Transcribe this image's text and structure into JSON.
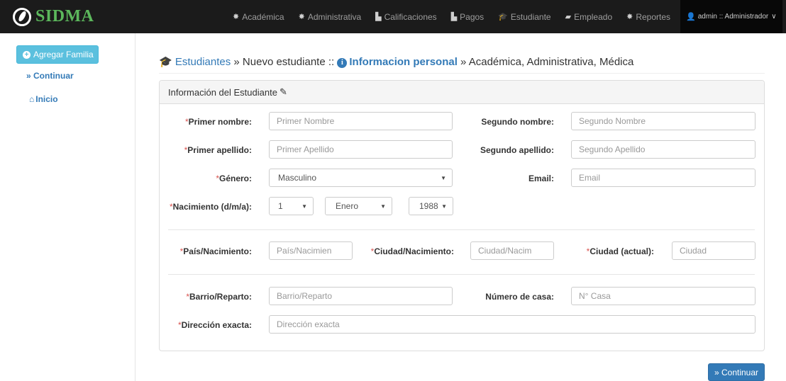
{
  "navbar": {
    "brand": "SIDMA",
    "items": [
      {
        "icon": "gear-icon",
        "glyph": "✸",
        "label": "Académica"
      },
      {
        "icon": "gear-icon",
        "glyph": "✸",
        "label": "Administrativa"
      },
      {
        "icon": "file-icon",
        "glyph": "▙",
        "label": "Calificaciones"
      },
      {
        "icon": "file-icon",
        "glyph": "▙",
        "label": "Pagos"
      },
      {
        "icon": "graduation-cap-icon",
        "glyph": "🎓",
        "label": "Estudiante"
      },
      {
        "icon": "folder-open-icon",
        "glyph": "▰",
        "label": "Empleado"
      },
      {
        "icon": "gear-icon",
        "glyph": "✸",
        "label": "Reportes"
      }
    ],
    "user": "admin :: Administrador"
  },
  "sidebar": {
    "add_family": "Agregar Familia",
    "continuar": "» Continuar",
    "inicio": "Inicio"
  },
  "breadcrumb": {
    "estudiantes": "Estudiantes",
    "nuevo": " » Nuevo estudiante :: ",
    "info_personal": "Informacion personal",
    "rest": " » Académica, Administrativa, Médica"
  },
  "panel": {
    "title": "Información del Estudiante"
  },
  "form": {
    "primer_nombre": {
      "label": "Primer nombre:",
      "placeholder": "Primer Nombre"
    },
    "segundo_nombre": {
      "label": "Segundo nombre:",
      "placeholder": "Segundo Nombre"
    },
    "primer_apellido": {
      "label": "Primer apellido:",
      "placeholder": "Primer Apellido"
    },
    "segundo_apellido": {
      "label": "Segundo apellido:",
      "placeholder": "Segundo Apellido"
    },
    "genero": {
      "label": "Género:",
      "value": "Masculino"
    },
    "email": {
      "label": "Email:",
      "placeholder": "Email"
    },
    "nacimiento": {
      "label": "Nacimiento (d/m/a):",
      "day": "1",
      "month": "Enero",
      "year": "1988"
    },
    "pais_nacimiento": {
      "label": "País/Nacimiento:",
      "placeholder": "País/Nacimien"
    },
    "ciudad_nacimiento": {
      "label": "Ciudad/Nacimiento:",
      "placeholder": "Ciudad/Nacim"
    },
    "ciudad_actual": {
      "label": "Ciudad (actual):",
      "placeholder": "Ciudad"
    },
    "barrio": {
      "label": "Barrio/Reparto:",
      "placeholder": "Barrio/Reparto"
    },
    "numero_casa": {
      "label": "Número de casa:",
      "placeholder": "N° Casa"
    },
    "direccion": {
      "label": "Dirección exacta:",
      "placeholder": "Dirección exacta"
    }
  },
  "footer": {
    "continuar": "» Continuar"
  },
  "colors": {
    "navbar": "#1b1b1b",
    "brand": "#5cb85c",
    "link": "#337ab7",
    "info_button": "#5bc0de",
    "required": "#d9534f"
  }
}
